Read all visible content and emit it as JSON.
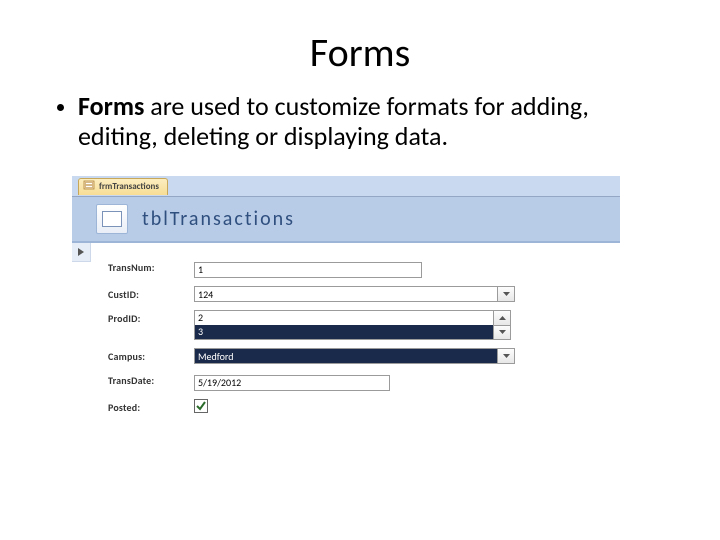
{
  "title": "Forms",
  "bullet": {
    "bold": "Forms ",
    "rest": "are used to customize formats for adding, editing, deleting or displaying data."
  },
  "form": {
    "tab_label": "frmTransactions",
    "header_title": "tblTransactions",
    "fields": {
      "transnum": {
        "label": "TransNum:",
        "value": "1"
      },
      "custid": {
        "label": "CustID:",
        "value": "124"
      },
      "prodid": {
        "label": "ProdID:",
        "opt1": "2",
        "opt2": "3"
      },
      "campus": {
        "label": "Campus:",
        "value": "Medford"
      },
      "transdate": {
        "label": "TransDate:",
        "value": "5/19/2012"
      },
      "posted": {
        "label": "Posted:",
        "checked": true
      }
    }
  }
}
